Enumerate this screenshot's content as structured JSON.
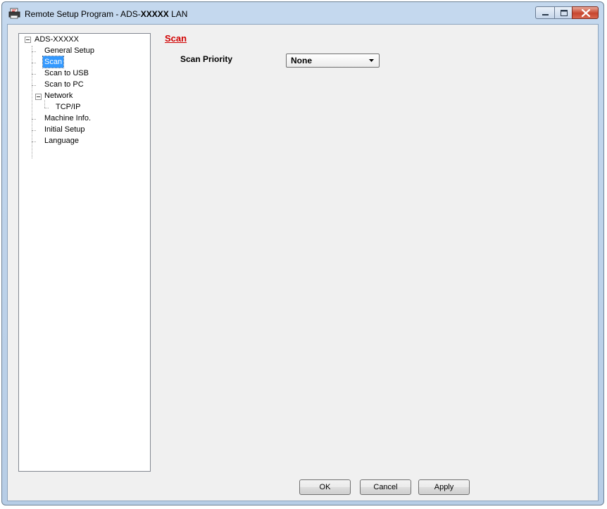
{
  "window": {
    "title_prefix": "Remote Setup Program - ADS-",
    "title_bold": "XXXXX",
    "title_suffix": " LAN"
  },
  "tree": {
    "root": "ADS-XXXXX",
    "items": [
      {
        "label": "General Setup"
      },
      {
        "label": "Scan",
        "selected": true
      },
      {
        "label": "Scan to USB"
      },
      {
        "label": "Scan to PC"
      },
      {
        "label": "Network",
        "expanded": true,
        "children": [
          {
            "label": "TCP/IP"
          }
        ]
      },
      {
        "label": "Machine Info."
      },
      {
        "label": "Initial Setup"
      },
      {
        "label": "Language"
      }
    ]
  },
  "panel": {
    "title": "Scan",
    "field_label": "Scan Priority",
    "field_value": "None"
  },
  "buttons": {
    "ok": "OK",
    "cancel": "Cancel",
    "apply": "Apply"
  },
  "colors": {
    "section_title": "#d10000",
    "selection": "#3399ff"
  }
}
